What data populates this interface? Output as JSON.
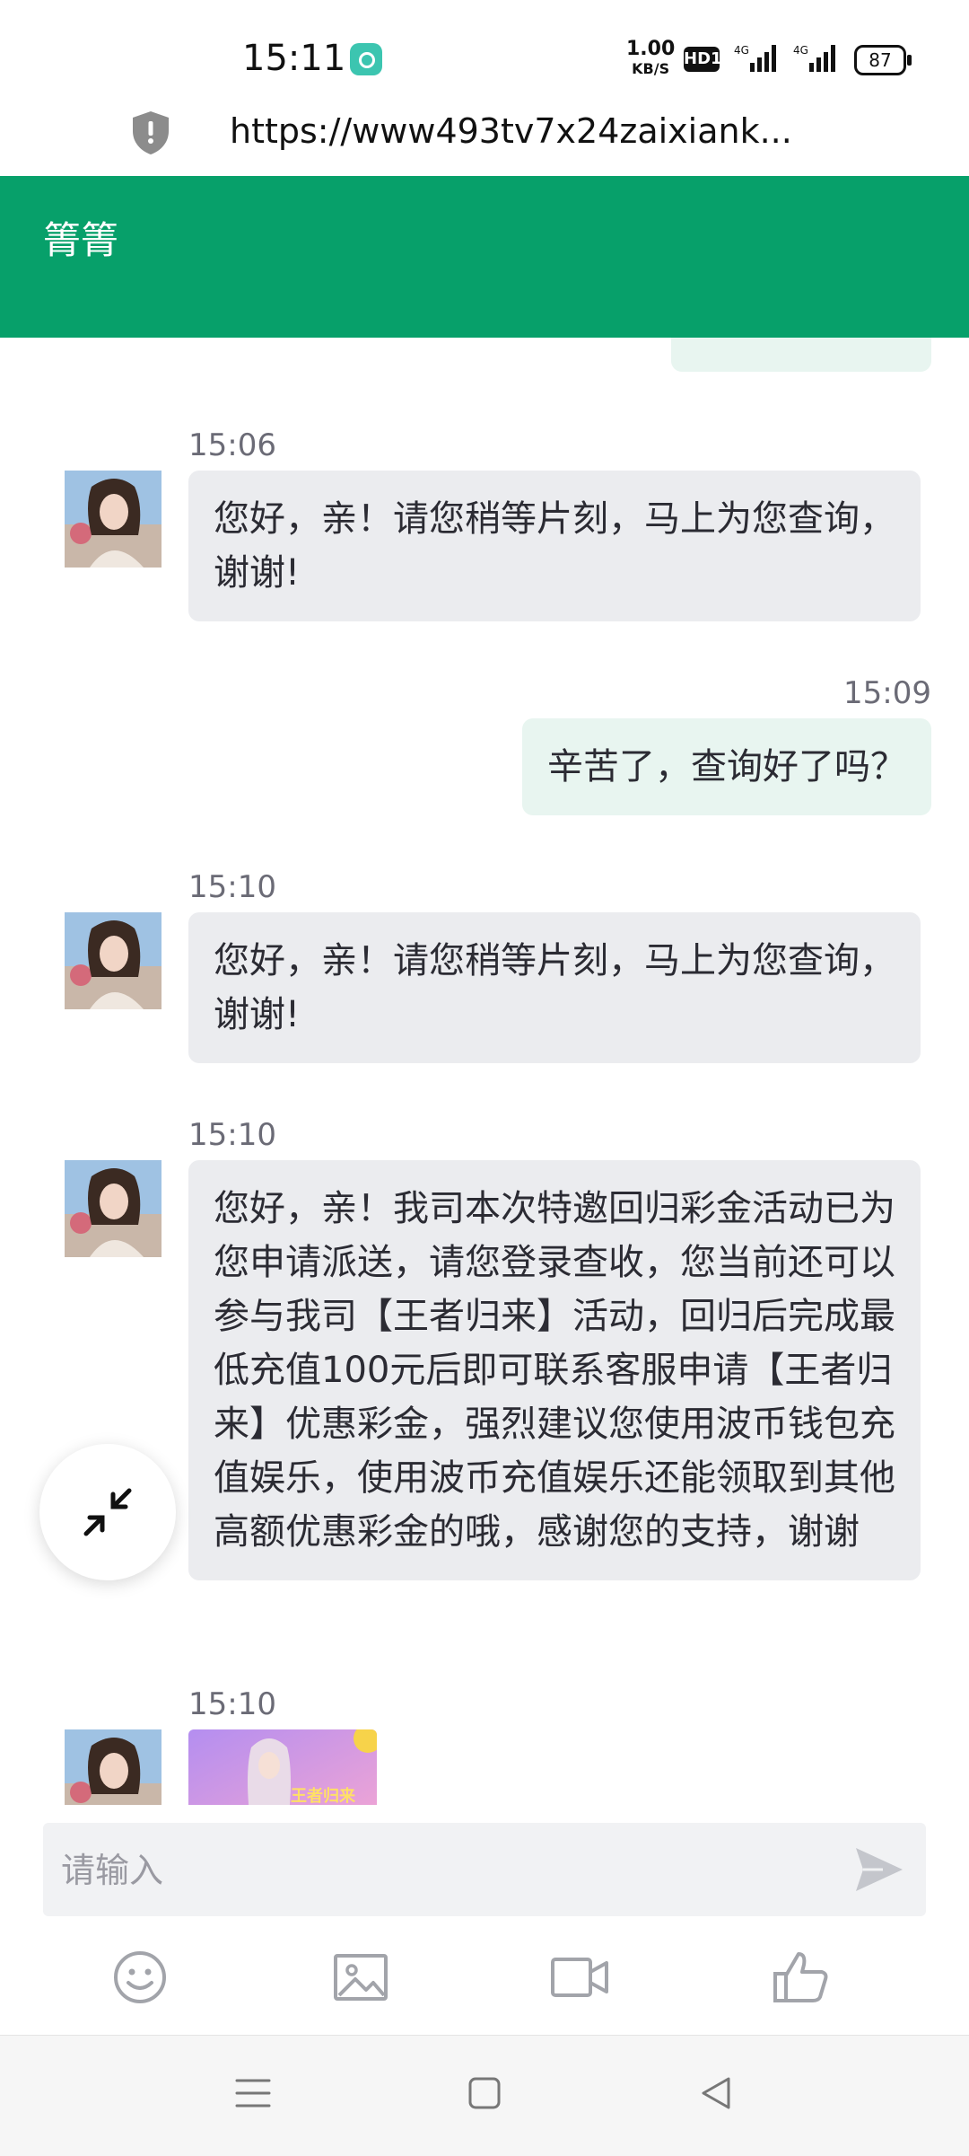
{
  "status_bar": {
    "time": "15:11",
    "net_speed_value": "1.00",
    "net_speed_unit": "KB/S",
    "hd_label": "HD1",
    "signal1_label": "4G",
    "signal2_label": "4G",
    "battery": "87"
  },
  "browser": {
    "url": "https://www493tv7x24zaixiank..."
  },
  "header": {
    "title": "箐箐"
  },
  "messages": [
    {
      "time": "15:06",
      "text": "您好，亲！请您稍等片刻，马上为您查询，谢谢!"
    },
    {
      "time": "15:09",
      "text": "辛苦了，查询好了吗？"
    },
    {
      "time": "15:10",
      "text": "您好，亲！请您稍等片刻，马上为您查询，谢谢!"
    },
    {
      "time": "15:10",
      "text": "您好，亲！我司本次特邀回归彩金活动已为您申请派送，请您登录查收，您当前还可以参与我司【王者归来】活动，回归后完成最低充值100元后即可联系客服申请【王者归来】优惠彩金，强烈建议您使用波币钱包充值娱乐，使用波币充值娱乐还能领取到其他高额优惠彩金的哦，感谢您的支持，谢谢"
    },
    {
      "time": "15:10",
      "image_caption": "王者归来"
    }
  ],
  "input": {
    "placeholder": "请输入"
  },
  "colors": {
    "header_green": "#07a06a",
    "incoming_bubble": "#ebecef",
    "outgoing_bubble": "#e8f5f0"
  },
  "icons": {
    "toolbar": [
      "emoji-icon",
      "image-icon",
      "video-icon",
      "thumbs-up-icon"
    ],
    "nav": [
      "menu-icon",
      "home-icon",
      "back-icon"
    ]
  }
}
